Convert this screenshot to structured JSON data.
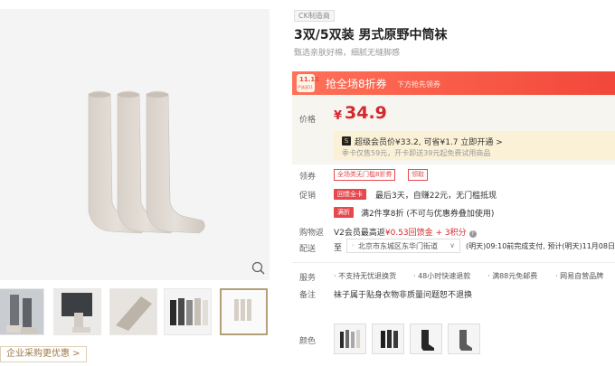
{
  "gallery": {
    "zoom_icon": "search-icon",
    "thumbnails": [
      "model-wearing-socks",
      "model-wearing-socks-2",
      "folded-sock",
      "multi-color-socks",
      "three-grey-socks"
    ],
    "corp_link": "企业采购更优惠 >"
  },
  "product": {
    "brand_tag": "CK制造商",
    "title": "3双/5双装 男式原野中筒袜",
    "subtitle": "甄选亲肤好棉，细腻无缝脚感"
  },
  "promo": {
    "logo_line1": "11.11",
    "logo_line2": "严选双11",
    "title": "抢全场8折券",
    "subtitle": "下方抢先领券"
  },
  "price": {
    "label": "价格",
    "currency": "¥",
    "value": "34.9",
    "vip_icon": "S",
    "vip_text": "超级会员价¥33.2, 可省¥1.7  立即开通 >",
    "vip_sub": "季卡仅售59元，开卡即送39元起免费试用商品"
  },
  "coupon": {
    "label": "领券",
    "items": [
      "全场类无门槛8折券",
      "领取"
    ]
  },
  "promotion": {
    "label": "促销",
    "lines": [
      {
        "tag": "回馈全卡",
        "text": "最后3天，自赚22元，无门槛抵现"
      },
      {
        "tag": "满折",
        "text": "满2件享8折 (不可与优惠券叠加使用)"
      }
    ]
  },
  "rebate": {
    "label": "购物返",
    "text_pre": "V2会员最高返",
    "text_red": "¥0.53回馈金 + 3积分",
    "info_icon": "info-icon"
  },
  "delivery": {
    "label": "配送",
    "prefix": "至",
    "address": "北京市东城区东华门街道",
    "note": "(明天)09:10前完成支付, 预计(明天)11月08日"
  },
  "service": {
    "label": "服务",
    "items": [
      "· 不支持无忧退换货",
      "· 48小时快速退款",
      "· 满88元免邮费",
      "· 网易自营品牌"
    ]
  },
  "remark": {
    "label": "备注",
    "text": "袜子属于贴身衣物非质量问题恕不退换"
  },
  "color": {
    "label": "颜色",
    "options": [
      "sock-color-1",
      "sock-color-2",
      "sock-color-3",
      "sock-color-4"
    ]
  },
  "colors": {
    "price_red": "#d4282d",
    "promo_red": "#f2473a",
    "vip_bg": "#fbf1d6",
    "active_border": "#b4a078"
  }
}
